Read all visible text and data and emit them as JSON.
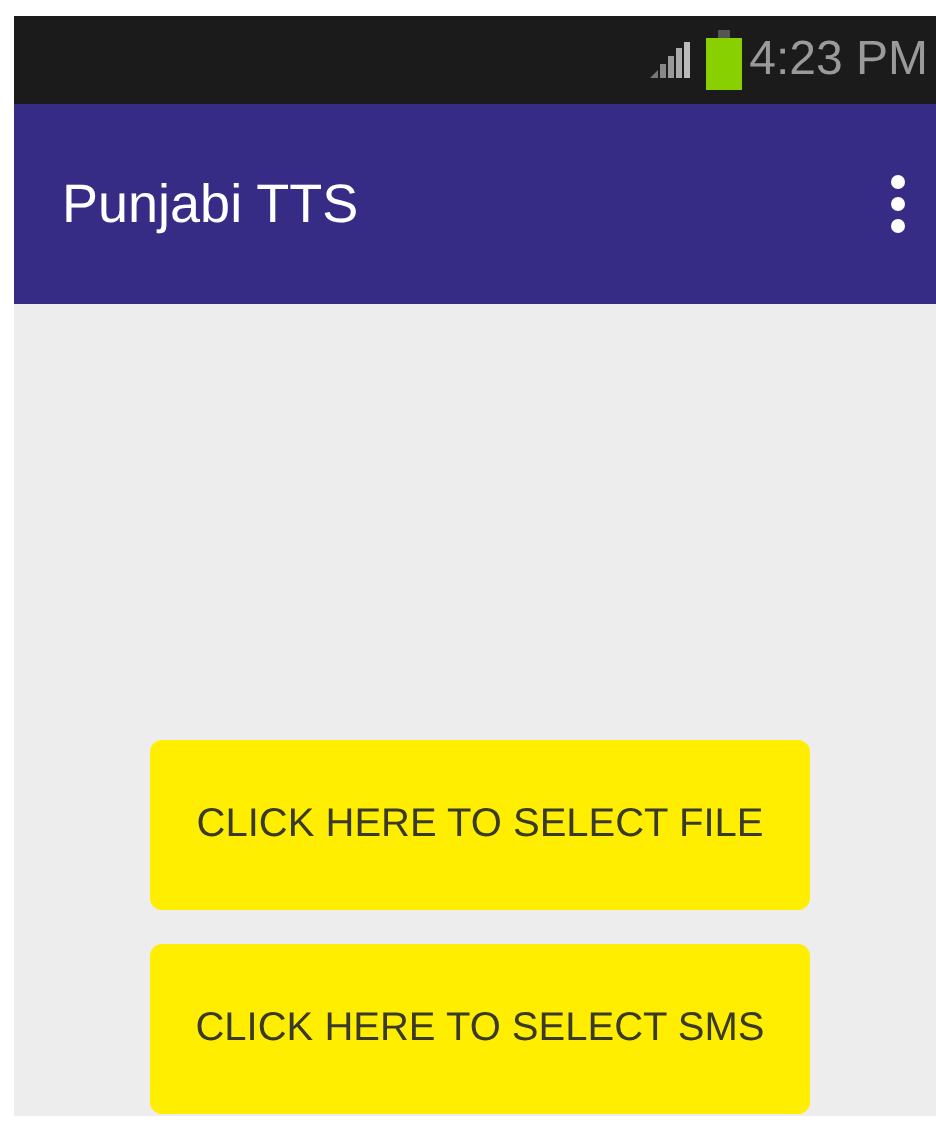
{
  "status_bar": {
    "time": "4:23 PM"
  },
  "app_bar": {
    "title": "Punjabi TTS"
  },
  "buttons": [
    {
      "label": "CLICK HERE TO SELECT FILE"
    },
    {
      "label": "CLICK HERE TO SELECT SMS"
    }
  ]
}
